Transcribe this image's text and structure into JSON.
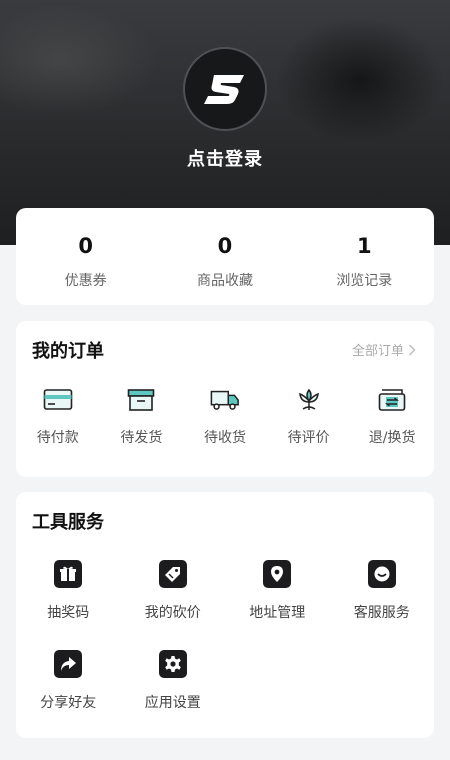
{
  "profile": {
    "login_text": "点击登录",
    "logo_letter": "S"
  },
  "stats": [
    {
      "value": "0",
      "label": "优惠券"
    },
    {
      "value": "0",
      "label": "商品收藏"
    },
    {
      "value": "1",
      "label": "浏览记录"
    }
  ],
  "orders": {
    "title": "我的订单",
    "all_label": "全部订单",
    "items": [
      {
        "label": "待付款",
        "icon": "card-icon"
      },
      {
        "label": "待发货",
        "icon": "box-icon"
      },
      {
        "label": "待收货",
        "icon": "truck-icon"
      },
      {
        "label": "待评价",
        "icon": "flower-icon"
      },
      {
        "label": "退/换货",
        "icon": "exchange-icon"
      }
    ]
  },
  "tools": {
    "title": "工具服务",
    "items": [
      {
        "label": "抽奖码",
        "icon": "gift-icon"
      },
      {
        "label": "我的砍价",
        "icon": "tag-icon"
      },
      {
        "label": "地址管理",
        "icon": "location-pin-icon"
      },
      {
        "label": "客服服务",
        "icon": "chat-icon"
      },
      {
        "label": "分享好友",
        "icon": "share-icon"
      },
      {
        "label": "应用设置",
        "icon": "settings-icon"
      }
    ]
  },
  "colors": {
    "accent_teal": "#5ec7c2",
    "icon_dark": "#1c1c1e"
  }
}
